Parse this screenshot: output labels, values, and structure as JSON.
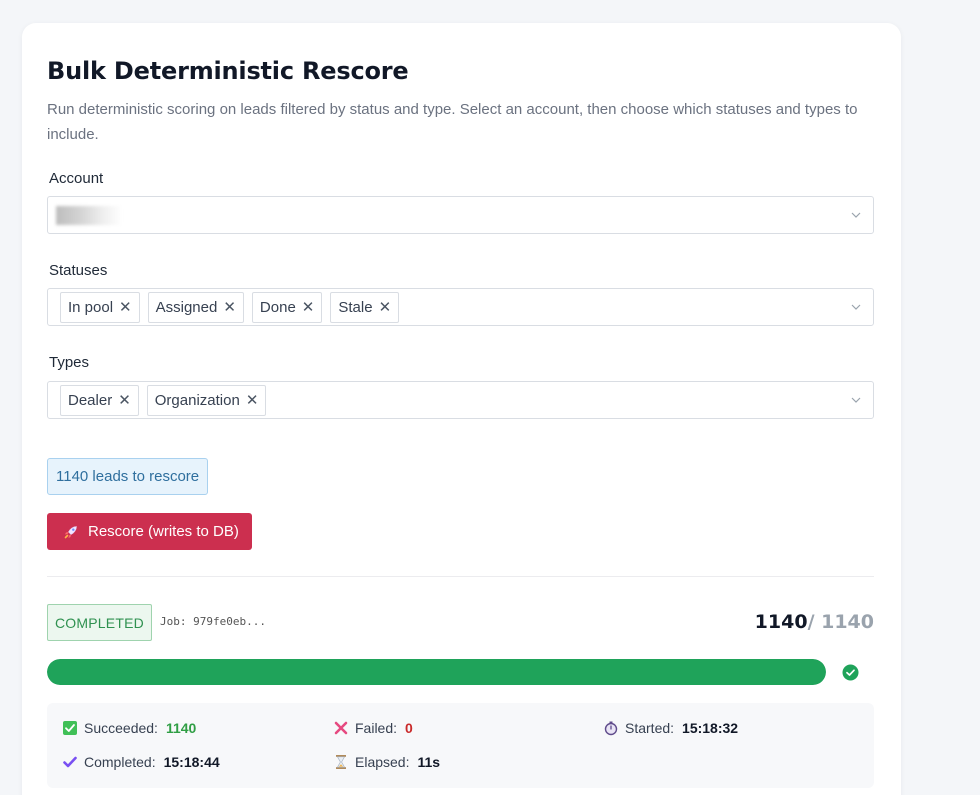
{
  "page": {
    "title": "Bulk Deterministic Rescore",
    "subtitle": "Run deterministic scoring on leads filtered by status and type. Select an account, then choose which statuses and types to include."
  },
  "account": {
    "label": "Account"
  },
  "statuses": {
    "label": "Statuses",
    "chips": [
      "In pool",
      "Assigned",
      "Done",
      "Stale"
    ]
  },
  "types": {
    "label": "Types",
    "chips": [
      "Dealer",
      "Organization"
    ]
  },
  "remove_glyph": "✕",
  "leads_count_text": "1140 leads to rescore",
  "rescore_button": {
    "icon": "rocket-icon",
    "label": "Rescore (writes to DB)"
  },
  "job": {
    "status": "COMPLETED",
    "id_text": "Job: 979fe0eb...",
    "processed": "1140",
    "total": "/ 1140",
    "progress_fraction": 1.0
  },
  "stats": {
    "succeeded": {
      "label": "Succeeded:",
      "value": "1140",
      "color": "#2f9e44"
    },
    "failed": {
      "label": "Failed:",
      "value": "0",
      "color": "#c92a2a"
    },
    "started": {
      "label": "Started:",
      "value": "15:18:32"
    },
    "completed": {
      "label": "Completed:",
      "value": "15:18:44"
    },
    "elapsed": {
      "label": "Elapsed:",
      "value": "11s"
    }
  },
  "colors": {
    "accent_button": "#cc2f4f",
    "progress": "#1fa35a",
    "info_box": "#e7f3fc"
  }
}
